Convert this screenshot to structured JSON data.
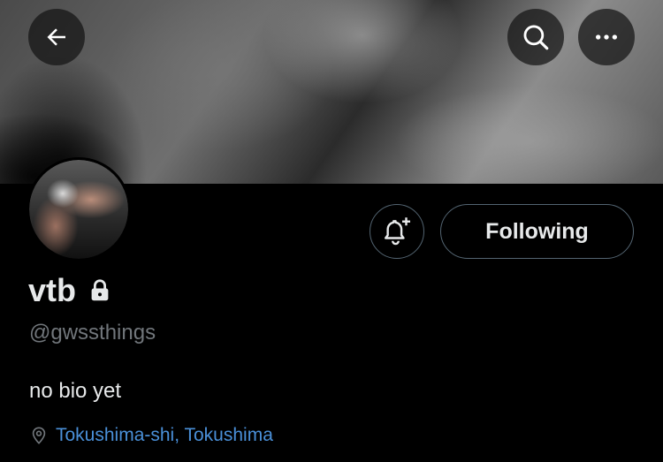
{
  "header": {
    "back_icon": "arrow-left-icon",
    "search_icon": "search-icon",
    "more_icon": "more-horizontal-icon"
  },
  "profile": {
    "display_name": "vtb",
    "protected_icon": "lock-icon",
    "handle": "@gwssthings",
    "bio": "no bio yet",
    "location": "Tokushima-shi, Tokushima",
    "location_icon": "location-pin-icon"
  },
  "actions": {
    "notify_icon": "bell-plus-icon",
    "following_label": "Following"
  },
  "colors": {
    "background": "#000000",
    "text_primary": "#e7e9ea",
    "text_secondary": "#71767b",
    "link": "#4a90d9",
    "button_border": "#536471"
  }
}
